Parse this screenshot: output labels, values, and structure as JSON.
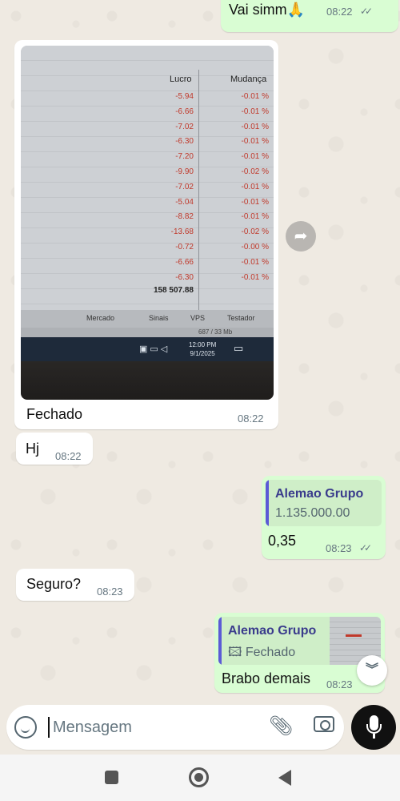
{
  "messages": {
    "top": {
      "text": "Vai simm🙏",
      "time": "08:22",
      "ticks": "✓✓"
    },
    "image": {
      "caption": "Fechado",
      "time": "08:22",
      "screen": {
        "headers": {
          "lucro": "Lucro",
          "mudanca": "Mudança"
        },
        "rows": [
          {
            "lucro": "-5.94",
            "mudanca": "-0.01 %"
          },
          {
            "lucro": "-6.66",
            "mudanca": "-0.01 %"
          },
          {
            "lucro": "-7.02",
            "mudanca": "-0.01 %"
          },
          {
            "lucro": "-6.30",
            "mudanca": "-0.01 %"
          },
          {
            "lucro": "-7.20",
            "mudanca": "-0.01 %"
          },
          {
            "lucro": "-9.90",
            "mudanca": "-0.02 %"
          },
          {
            "lucro": "-7.02",
            "mudanca": "-0.01 %"
          },
          {
            "lucro": "-5.04",
            "mudanca": "-0.01 %"
          },
          {
            "lucro": "-8.82",
            "mudanca": "-0.01 %"
          },
          {
            "lucro": "-13.68",
            "mudanca": "-0.02 %"
          },
          {
            "lucro": "-0.72",
            "mudanca": "-0.00 %"
          },
          {
            "lucro": "-6.66",
            "mudanca": "-0.01 %"
          },
          {
            "lucro": "-6.30",
            "mudanca": "-0.01 %"
          }
        ],
        "total": "158 507.88",
        "status": {
          "mercado": "Mercado",
          "sinais": "Sinais",
          "vps": "VPS",
          "testador": "Testador"
        },
        "net": "687 / 33 Mb",
        "clock_time": "12:00 PM",
        "clock_date": "9/1/2025"
      }
    },
    "hj": {
      "text": "Hj",
      "time": "08:22"
    },
    "quote1": {
      "quote_name": "Alemao Grupo",
      "quote_text": "1.135.000.00",
      "text": "0,35",
      "time": "08:23",
      "ticks": "✓✓"
    },
    "seguro": {
      "text": "Seguro?",
      "time": "08:23"
    },
    "quote2": {
      "quote_name": "Alemao Grupo",
      "quote_text": "Fechado",
      "text": "Brabo demais",
      "time": "08:23"
    }
  },
  "composer": {
    "placeholder": "Mensagem"
  },
  "icons": {
    "forward": "forward-icon",
    "scroll_down": "chevrons-down-icon",
    "emoji": "sticker-icon",
    "attach": "paperclip-icon",
    "camera": "camera-icon",
    "mic": "microphone-icon"
  },
  "colors": {
    "incoming": "#ffffff",
    "outgoing": "#d9fdd3",
    "background": "#efeae2",
    "quote_bar": "#5b5bd6"
  }
}
